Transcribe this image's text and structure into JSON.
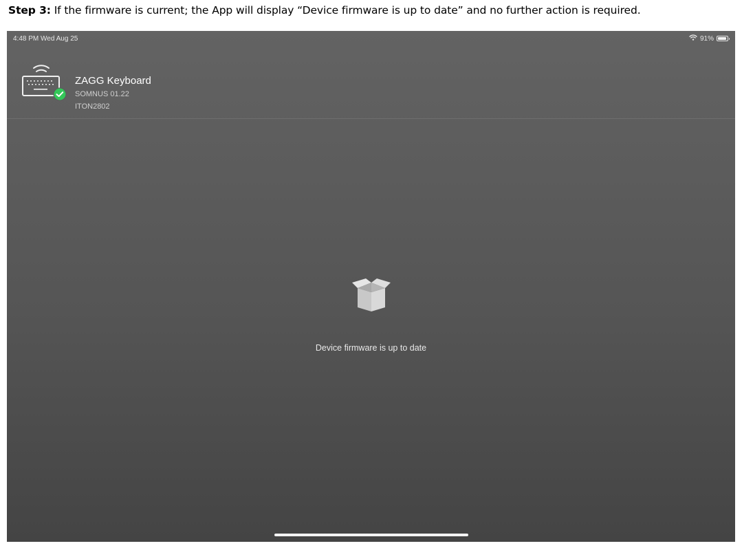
{
  "caption": {
    "step_label": "Step 3:",
    "text": " If the firmware is current; the App will display “Device firmware is up to date” and no further action is required."
  },
  "status_bar": {
    "time": "4:48 PM  Wed Aug 25",
    "battery_text": "91%",
    "battery_level": 0.91,
    "icons": [
      "wifi-icon",
      "battery-icon"
    ]
  },
  "device": {
    "name": "ZAGG Keyboard",
    "firmware": "SOMNUS 01.22",
    "id": "ITON2802",
    "icon": "keyboard-icon",
    "status_icon": "check-badge-icon",
    "status_color": "#34c759"
  },
  "main": {
    "icon": "box-icon",
    "message": "Device firmware is up to date"
  }
}
